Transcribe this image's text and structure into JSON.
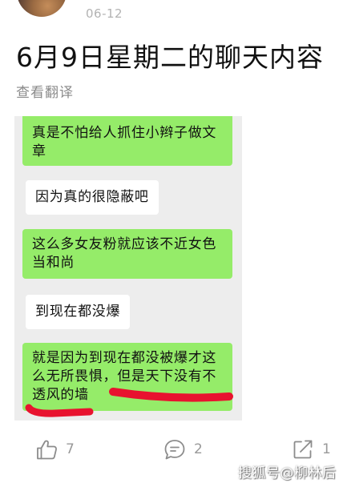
{
  "post": {
    "date": "06-12",
    "title": "6月9日星期二的聊天内容",
    "translate_link": "查看翻译"
  },
  "chat": {
    "messages": [
      {
        "lines": [
          "真是不怕给人抓住小辫子做文",
          "章"
        ]
      },
      {
        "lines": [
          "因为真的很隐蔽吧"
        ]
      },
      {
        "lines": [
          "这么多女友粉就应该不近女色",
          "当和尚"
        ]
      },
      {
        "lines": [
          "到现在都没爆"
        ]
      },
      {
        "lines": [
          "就是因为到现在都没被爆才这",
          "么无所畏惧，但是天下没有不",
          "透风的墙"
        ]
      }
    ]
  },
  "actions": {
    "like": {
      "icon": "thumbs-up-icon",
      "count": "7"
    },
    "comment": {
      "icon": "comment-icon",
      "count": "2"
    },
    "share": {
      "icon": "share-icon",
      "count": "1"
    }
  },
  "watermark": "搜狐号@柳林后",
  "colors": {
    "text": "#111111",
    "secondary_text": "#999999",
    "icon": "#8c8c8c",
    "chat_background": "#ededed",
    "sent_bubble": "#95ec69",
    "received_bubble": "#ffffff",
    "highlight_mark": "#e8132f"
  }
}
